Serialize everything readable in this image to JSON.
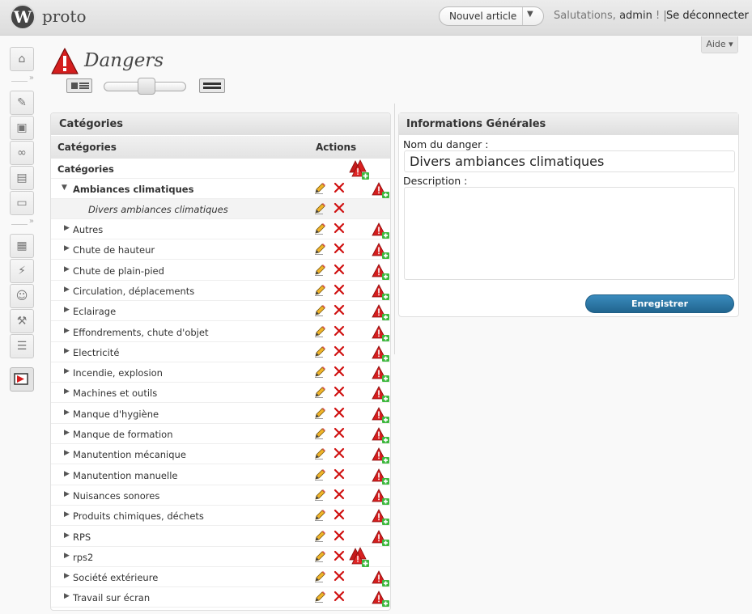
{
  "topbar": {
    "site_title": "proto",
    "new_article": "Nouvel article",
    "greeting": "Salutations,",
    "username": "admin",
    "greeting_end": "! |",
    "logout": "Se déconnecter",
    "help": "Aide ▾"
  },
  "page": {
    "title": "Dangers"
  },
  "categories_panel": {
    "title": "Catégories",
    "col_categories": "Catégories",
    "col_actions": "Actions",
    "root_label": "Catégories",
    "expanded_category": "Ambiances climatiques",
    "sub_item": "Divers ambiances climatiques",
    "items": [
      "Autres",
      "Chute de hauteur",
      "Chute de plain-pied",
      "Circulation, déplacements",
      "Eclairage",
      "Effondrements, chute d'objet",
      "Electricité",
      "Incendie, explosion",
      "Machines et outils",
      "Manque d'hygiène",
      "Manque de formation",
      "Manutention mécanique",
      "Manutention manuelle",
      "Nuisances sonores",
      "Produits chimiques, déchets",
      "RPS",
      "rps2",
      "Société extérieure",
      "Travail sur écran"
    ]
  },
  "info_panel": {
    "title": "Informations Générales",
    "name_label": "Nom du danger :",
    "name_value": "Divers ambiances climatiques",
    "description_label": "Description :",
    "description_value": "",
    "save_button": "Enregistrer"
  },
  "colors": {
    "accent_blue": "#21658f",
    "danger_red": "#cc1111",
    "add_green": "#2aa52a"
  }
}
